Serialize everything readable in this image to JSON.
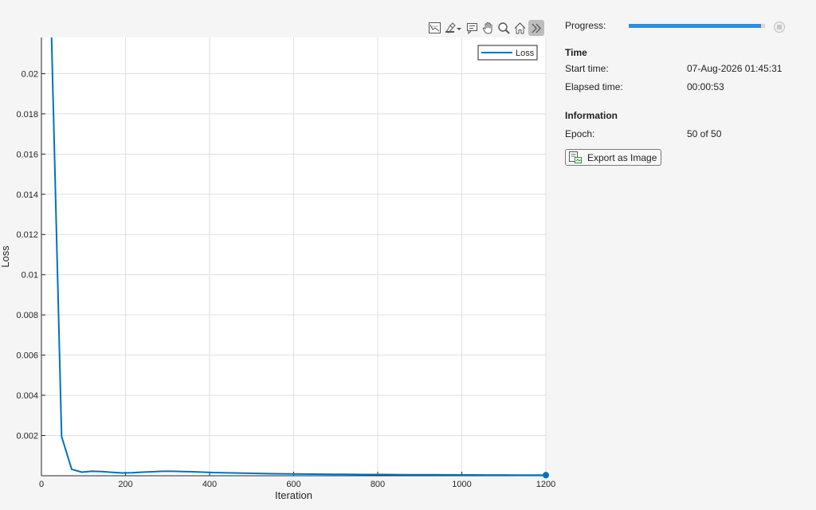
{
  "chart_data": {
    "type": "line",
    "xlabel": "Iteration",
    "ylabel": "Loss",
    "xlim": [
      0,
      1200
    ],
    "ylim": [
      0,
      0.0218
    ],
    "x_ticks": [
      0,
      200,
      400,
      600,
      800,
      1000,
      1200
    ],
    "x_tick_labels": [
      "0",
      "200",
      "400",
      "600",
      "800",
      "1000",
      "1200"
    ],
    "y_ticks": [
      0.002,
      0.004,
      0.006,
      0.008,
      0.01,
      0.012,
      0.014,
      0.016,
      0.018,
      0.02
    ],
    "y_tick_labels": [
      "0.002",
      "0.004",
      "0.006",
      "0.008",
      "0.01",
      "0.012",
      "0.014",
      "0.016",
      "0.018",
      "0.02"
    ],
    "grid": true,
    "legend": "top-right",
    "series": [
      {
        "name": "Loss",
        "color": "#0072bd",
        "x": [
          24,
          48,
          72,
          96,
          120,
          144,
          168,
          192,
          216,
          240,
          264,
          288,
          312,
          336,
          360,
          384,
          408,
          432,
          456,
          480,
          504,
          528,
          552,
          576,
          600,
          624,
          648,
          672,
          696,
          720,
          744,
          768,
          792,
          816,
          840,
          864,
          888,
          912,
          936,
          960,
          984,
          1008,
          1032,
          1056,
          1080,
          1104,
          1128,
          1152,
          1176,
          1200
        ],
        "y": [
          0.0218,
          0.00195,
          0.00032,
          0.00018,
          0.00022,
          0.00021,
          0.00017,
          0.00014,
          0.00015,
          0.00018,
          0.0002,
          0.00022,
          0.00022,
          0.00021,
          0.0002,
          0.00018,
          0.00016,
          0.00015,
          0.00014,
          0.00013,
          0.00012,
          0.00011,
          0.0001,
          9.5e-05,
          9e-05,
          8.5e-05,
          8e-05,
          7.5e-05,
          7e-05,
          7e-05,
          6.5e-05,
          6e-05,
          6e-05,
          5.8e-05,
          5.5e-05,
          5.2e-05,
          5e-05,
          4.8e-05,
          4.6e-05,
          4.4e-05,
          4.2e-05,
          4e-05,
          3.8e-05,
          3.6e-05,
          3.5e-05,
          3.4e-05,
          3.3e-05,
          3.2e-05,
          3.1e-05,
          3e-05
        ]
      }
    ],
    "final_marker": true
  },
  "toolbar": {
    "icons": [
      "export-icon",
      "brush-icon",
      "datatip-icon",
      "pan-icon",
      "zoom-icon",
      "home-icon",
      "collapse-icon"
    ]
  },
  "panel": {
    "progress_label": "Progress:",
    "progress_value": 0.97,
    "time_title": "Time",
    "start_label": "Start time:",
    "start_value": "07-Aug-2026 01:45:31",
    "elapsed_label": "Elapsed time:",
    "elapsed_value": "00:00:53",
    "info_title": "Information",
    "epoch_label": "Epoch:",
    "epoch_value": "50 of 50",
    "export_label": "Export as Image"
  }
}
